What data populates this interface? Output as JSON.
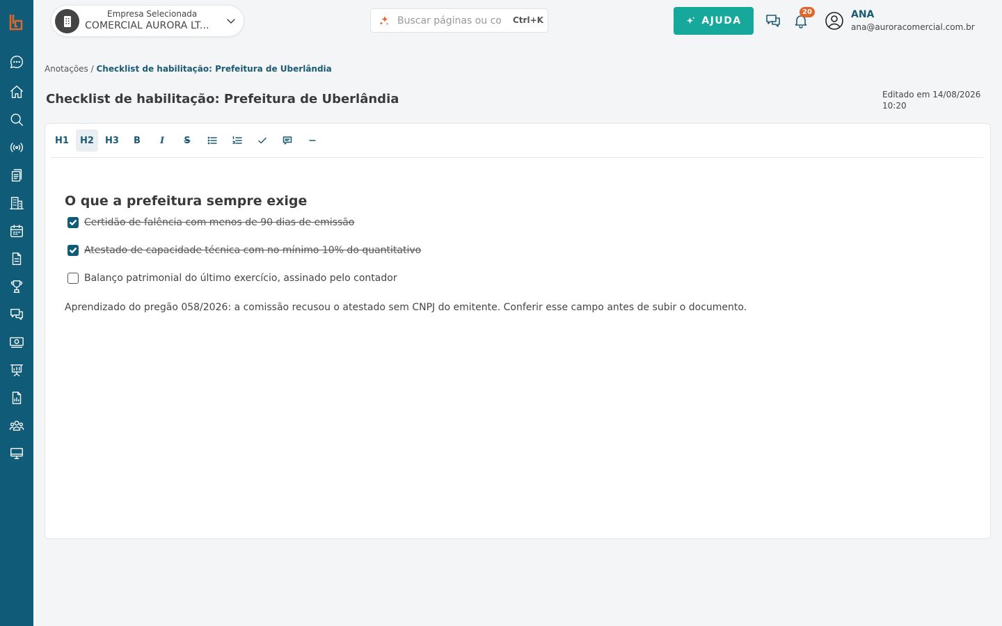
{
  "sidebar": {
    "items": [
      {
        "name": "chat-icon"
      },
      {
        "name": "home-icon"
      },
      {
        "name": "search-icon"
      },
      {
        "name": "broadcast-icon"
      },
      {
        "name": "documents-icon"
      },
      {
        "name": "building-icon"
      },
      {
        "name": "calendar-icon"
      },
      {
        "name": "file-icon"
      },
      {
        "name": "trophy-icon"
      },
      {
        "name": "messages-icon"
      },
      {
        "name": "money-icon"
      },
      {
        "name": "presentation-icon"
      },
      {
        "name": "report-icon"
      },
      {
        "name": "users-icon"
      },
      {
        "name": "monitor-icon"
      }
    ]
  },
  "header": {
    "company_label": "Empresa Selecionada",
    "company_value": "COMERCIAL AURORA LT...",
    "search_placeholder": "Buscar páginas ou co",
    "search_shortcut": "Ctrl+K",
    "help_label": "AJUDA",
    "notification_count": "20",
    "user_name": "ANA",
    "user_email": "ana@auroracomercial.com.br"
  },
  "breadcrumb": {
    "parent": "Anotações",
    "separator": "/",
    "current": "Checklist de habilitação: Prefeitura de Uberlândia"
  },
  "page": {
    "title": "Checklist de habilitação: Prefeitura de Uberlândia",
    "edited_line1": "Editado em 14/08/2026",
    "edited_line2": "10:20"
  },
  "toolbar": {
    "h1": "H1",
    "h2": "H2",
    "h3": "H3",
    "bold": "B",
    "italic": "I",
    "strike": "S"
  },
  "document": {
    "heading": "O que a prefeitura sempre exige",
    "tasks": [
      {
        "text": "Certidão de falência com menos de 90 dias de emissão",
        "checked": true
      },
      {
        "text": "Atestado de capacidade técnica com no mínimo 10% do quantitativo",
        "checked": true
      },
      {
        "text": "Balanço patrimonial do último exercício, assinado pelo contador",
        "checked": false
      }
    ],
    "note": "Aprendizado do pregão 058/2026: a comissão recusou o atestado sem CNPJ do emitente. Conferir esse campo antes de subir o documento."
  },
  "colors": {
    "sidebar": "#0f5b78",
    "accent": "#16a89b",
    "badge": "#e0662a",
    "logo": "#e0662a"
  }
}
